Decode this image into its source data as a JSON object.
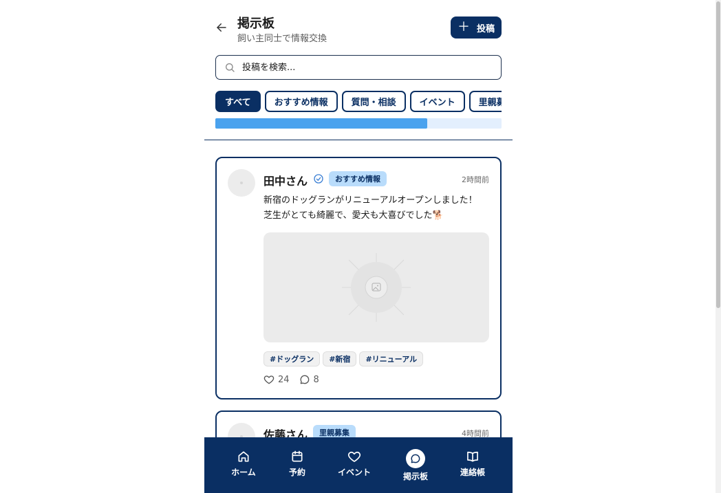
{
  "header": {
    "title": "掲示板",
    "subtitle": "飼い主同士で情報交換",
    "post_button_label": "投稿"
  },
  "search": {
    "placeholder": "投稿を検索..."
  },
  "filters": [
    {
      "label": "すべて",
      "active": true
    },
    {
      "label": "おすすめ情報",
      "active": false
    },
    {
      "label": "質問・相談",
      "active": false
    },
    {
      "label": "イベント",
      "active": false
    },
    {
      "label": "里親募集",
      "active": false
    }
  ],
  "progress": {
    "fraction": 0.74
  },
  "posts": [
    {
      "author": "田中さん",
      "verified": true,
      "category": "おすすめ情報",
      "time": "2時間前",
      "content": "新宿のドッグランがリニューアルオープンしました！芝生がとても綺麗で、愛犬も大喜びでした🐕",
      "has_image": true,
      "tags": [
        "#ドッグラン",
        "#新宿",
        "#リニューアル"
      ],
      "likes": "24",
      "comments": "8"
    },
    {
      "author": "佐藤さん",
      "verified": false,
      "category": "里親募集",
      "time": "4時間前"
    }
  ],
  "nav": [
    {
      "label": "ホーム",
      "icon": "home-icon",
      "active": false
    },
    {
      "label": "予約",
      "icon": "calendar-icon",
      "active": false
    },
    {
      "label": "イベント",
      "icon": "heart-icon",
      "active": false
    },
    {
      "label": "掲示板",
      "icon": "message-icon",
      "active": true
    },
    {
      "label": "連絡帳",
      "icon": "book-icon",
      "active": false
    }
  ],
  "colors": {
    "primary": "#0a2f63",
    "accent_blue": "#4aa2ee",
    "badge_bg": "#b9dcfb"
  }
}
